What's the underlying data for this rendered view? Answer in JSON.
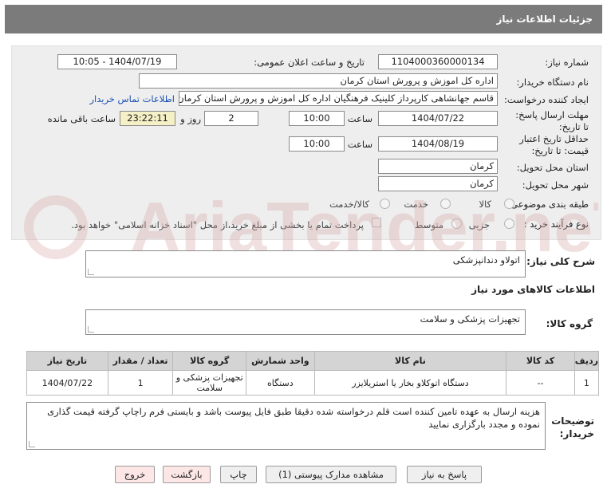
{
  "header": {
    "title": "جزئیات اطلاعات نیاز"
  },
  "form": {
    "need_number_label": "شماره نیاز:",
    "need_number": "1104000360000134",
    "announce_label": "تاریخ و ساعت اعلان عمومی:",
    "announce_value": "1404/07/19 - 10:05",
    "buyer_label": "نام دستگاه خریدار:",
    "buyer_value": "اداره کل اموزش و پرورش استان کرمان",
    "creator_label": "ایجاد کننده درخواست:",
    "creator_value": "قاسم جهانشاهی کارپرداز کلینیک فرهنگیان اداره کل اموزش و پرورش استان کرمان",
    "contact_link": "اطلاعات تماس خریدار",
    "reply_deadline_label": "مهلت ارسال پاسخ: تا تاریخ:",
    "reply_date": "1404/07/22",
    "time_label": "ساعت",
    "reply_time": "10:00",
    "days_value": "2",
    "days_label": "روز و",
    "remaining_time": "23:22:11",
    "remaining_label": "ساعت باقی مانده",
    "validity_label": "حداقل تاریخ اعتبار قیمت: تا تاریخ:",
    "validity_date": "1404/08/19",
    "validity_time": "10:00",
    "province_label": "استان محل تحویل:",
    "province_value": "کرمان",
    "city_label": "شهر محل تحویل:",
    "city_value": "کرمان",
    "category_label": "طبقه بندی موضوعی:",
    "category_options": [
      "کالا",
      "خدمت",
      "کالا/خدمت"
    ],
    "process_label": "نوع فرآیند خرید :",
    "process_options": [
      "جزیی",
      "متوسط"
    ],
    "payment_note": "پرداخت تمام یا بخشی از مبلغ خرید،از محل \"اسناد خزانه اسلامی\" خواهد بود."
  },
  "description": {
    "label": "شرح کلی نیاز:",
    "value": "اتولاو دندانپزشکی"
  },
  "goods_info": {
    "title": "اطلاعات کالاهای مورد نیاز",
    "group_label": "گروه کالا:",
    "group_value": "تجهیزات پزشکی و سلامت"
  },
  "table": {
    "headers": [
      "ردیف",
      "کد کالا",
      "نام کالا",
      "واحد شمارش",
      "گروه کالا",
      "تعداد / مقدار",
      "تاریخ نیاز"
    ],
    "rows": [
      [
        "1",
        "--",
        "دستگاه اتوکلاو بخار یا استریلایزر",
        "دستگاه",
        "تجهیزات پزشکی و سلامت",
        "1",
        "1404/07/22"
      ]
    ]
  },
  "buyer_notes": {
    "label": "توضیحات خریدار:",
    "value": "هزینه ارسال به عهده تامین کننده است قلم درخواسته شده دقیقا طبق فایل پیوست باشد و بایستی فرم راچاپ گرفته قیمت گذاری نموده و مجدد بارگزاری نمایید"
  },
  "buttons": {
    "reply": "پاسخ به نیاز",
    "attachments": "مشاهده مدارک پیوستی (1)",
    "print": "چاپ",
    "back": "بازگشت",
    "exit": "خروج"
  },
  "watermark": {
    "text": "AriaTender.neT"
  },
  "colors": {
    "header_bg": "#7b7b7b",
    "link": "#1a4fb5",
    "watermark": "#d9a9a9"
  }
}
